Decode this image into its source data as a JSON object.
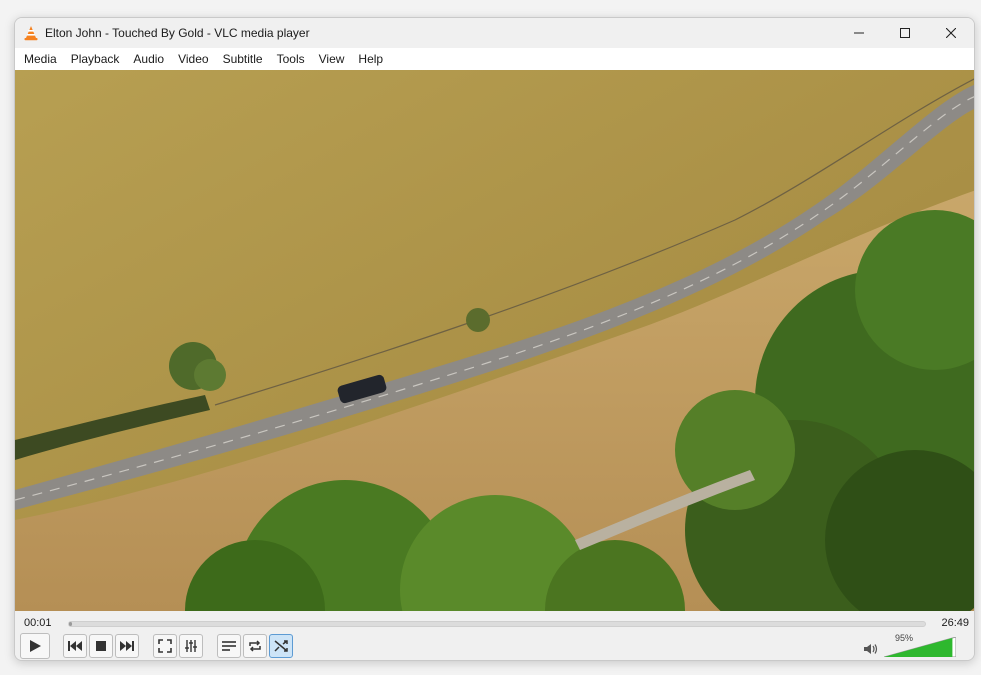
{
  "window": {
    "title": "Elton John - Touched By Gold - VLC media player"
  },
  "menu": {
    "items": [
      {
        "label": "Media",
        "name": "menu-media"
      },
      {
        "label": "Playback",
        "name": "menu-playback"
      },
      {
        "label": "Audio",
        "name": "menu-audio"
      },
      {
        "label": "Video",
        "name": "menu-video"
      },
      {
        "label": "Subtitle",
        "name": "menu-subtitle"
      },
      {
        "label": "Tools",
        "name": "menu-tools"
      },
      {
        "label": "View",
        "name": "menu-view"
      },
      {
        "label": "Help",
        "name": "menu-help"
      }
    ]
  },
  "playback": {
    "elapsed": "00:01",
    "total": "26:49",
    "progress_fraction": 0.0006
  },
  "volume": {
    "label": "95%",
    "level_fraction": 0.95
  },
  "colors": {
    "vlc_orange": "#f58220",
    "volume_green": "#2eb82e",
    "active_button": "#cde4f7"
  }
}
